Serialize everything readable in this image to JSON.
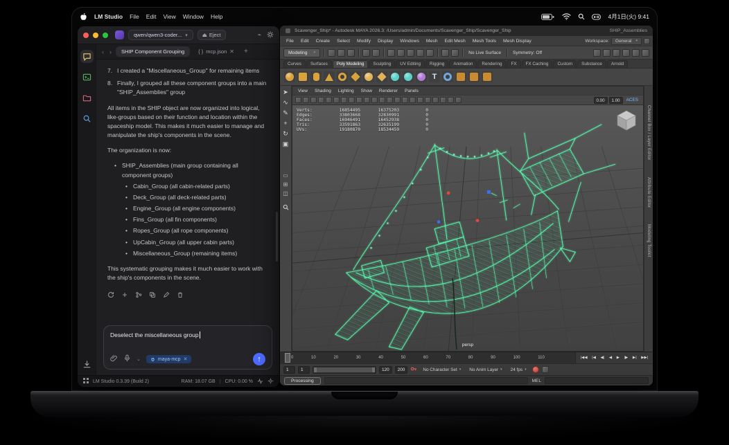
{
  "colors": {
    "accent_blue": "#4d6bfe",
    "selection_green": "#59ffb0",
    "chip_blue": "#1f3b66"
  },
  "menubar": {
    "app_name": "LM Studio",
    "items": [
      "File",
      "Edit",
      "View",
      "Window",
      "Help"
    ],
    "clock": "4月1日(火) 9:41"
  },
  "lmstudio": {
    "titlebar": {
      "model_selector": "qwen/qwen3-coder...",
      "eject_label": "Eject"
    },
    "tabs": {
      "active": "SHIP Component Grouping",
      "secondary": "mcp.json"
    },
    "chat": {
      "numbered": [
        {
          "num": "7.",
          "text": "I created a \"Miscellaneous_Group\" for remaining items"
        },
        {
          "num": "8.",
          "text": "Finally, I grouped all these component groups into a main \"SHIP_Assemblies\" group"
        }
      ],
      "para_summary": "All items in the SHIP object are now organized into logical, like-groups based on their function and location within the spaceship model. This makes it much easier to manage and manipulate the ship's components in the scene.",
      "para_org": "The organization is now:",
      "main_bullet": "SHIP_Assemblies (main group containing all component groups)",
      "sub_bullets": [
        "Cabin_Group (all cabin-related parts)",
        "Deck_Group (all deck-related parts)",
        "Engine_Group (all engine components)",
        "Fins_Group (all fin components)",
        "Ropes_Group (all rope components)",
        "UpCabin_Group (all upper cabin parts)",
        "Miscellaneous_Group (remaining items)"
      ],
      "para_closing": "This systematic grouping makes it much easier to work with the ship's components in the scene."
    },
    "composer": {
      "value": "Deselect the miscellaneous group",
      "chip": "maya-mcp"
    },
    "statusbar": {
      "version": "LM Studio 0.3.39 (Build 2)",
      "ram": "RAM: 18.07 GB",
      "cpu": "CPU: 0.00 %"
    }
  },
  "maya": {
    "title": "Scavenger_Ship* - Autodesk MAYA 2026.3: /Users/admin/Documents/Scavenger_Ship/Scavenger_Ship",
    "title_right": "SHIP_Assemblies",
    "menus": [
      "File",
      "Edit",
      "Create",
      "Select",
      "Modify",
      "Display",
      "Windows",
      "Mesh",
      "Edit Mesh",
      "Mesh Tools",
      "Mesh Display"
    ],
    "workspace_label": "Workspace:",
    "workspace_value": "General",
    "toolbar": {
      "mode": "Modeling",
      "no_live_surface": "No Live Surface",
      "symmetry": "Symmetry: Off"
    },
    "toolbar_icons_left": [
      "new-scene",
      "open-scene",
      "save-scene",
      "undo",
      "redo",
      "snap-to-grid",
      "snap-to-curve",
      "snap-to-point",
      "snap-to-projected-center",
      "snap-to-view-plane",
      "make-live",
      "construction-history"
    ],
    "toolbar_icons_right": [
      "render-current-frame",
      "ipr-render",
      "render-settings",
      "hypershade",
      "node-editor",
      "paint-effects"
    ],
    "shelf_tabs": [
      "Curves",
      "Surfaces",
      "Poly Modeling",
      "Sculpting",
      "UV Editing",
      "Rigging",
      "Animation",
      "Rendering",
      "FX",
      "FX Caching",
      "Custom",
      "Substance",
      "Arnold"
    ],
    "shelf_icons": [
      {
        "name": "poly-sphere",
        "shape": "circle",
        "color": "#d9a33c"
      },
      {
        "name": "poly-cube",
        "shape": "square",
        "color": "#d9a33c"
      },
      {
        "name": "poly-cylinder",
        "shape": "rect",
        "color": "#d9a33c"
      },
      {
        "name": "poly-cone",
        "shape": "triangle",
        "color": "#d9a33c"
      },
      {
        "name": "poly-torus",
        "shape": "ring",
        "color": "#d9a33c"
      },
      {
        "name": "poly-plane",
        "shape": "diamond",
        "color": "#d9a33c"
      },
      {
        "name": "poly-disc",
        "shape": "circle",
        "color": "#e0b25a"
      },
      {
        "name": "platonic-solid",
        "shape": "diamond",
        "color": "#e0b25a"
      },
      {
        "name": "super-ellipse",
        "shape": "circle",
        "color": "#5ad0c8"
      },
      {
        "name": "soccer-ball",
        "shape": "circle",
        "color": "#5ad0c8"
      },
      {
        "name": "ultra-shape",
        "shape": "circle",
        "color": "#b07cd6"
      },
      {
        "name": "type-tool",
        "shape": "letter-T",
        "color": "#cfe3f5"
      },
      {
        "name": "sweep-mesh",
        "shape": "ring",
        "color": "#6fa8dc"
      },
      {
        "name": "boolean",
        "shape": "square",
        "color": "#c98a30"
      },
      {
        "name": "combine",
        "shape": "square",
        "color": "#c98a30"
      },
      {
        "name": "separate",
        "shape": "square",
        "color": "#c98a30"
      }
    ],
    "toolbox": [
      {
        "name": "select-tool",
        "glyph": "➤"
      },
      {
        "name": "lasso-tool",
        "glyph": "∿"
      },
      {
        "name": "paint-select-tool",
        "glyph": "✎"
      },
      {
        "name": "move-tool",
        "glyph": "+"
      },
      {
        "name": "rotate-tool",
        "glyph": "↻"
      },
      {
        "name": "scale-tool",
        "glyph": "▣"
      }
    ],
    "toolbox_layouts": [
      {
        "name": "single-pane-layout",
        "glyph": "▭"
      },
      {
        "name": "four-pane-layout",
        "glyph": "⊞"
      },
      {
        "name": "two-pane-layout",
        "glyph": "◫"
      }
    ],
    "panel_menu": [
      "View",
      "Shading",
      "Lighting",
      "Show",
      "Renderer",
      "Panels"
    ],
    "viewport_icons": [
      "select-camera",
      "lock-camera",
      "camera-attributes",
      "bookmarks",
      "image-plane",
      "two-d-pan-zoom",
      "grease-pencil",
      "grid-toggle",
      "film-gate",
      "resolution-gate",
      "gate-mask",
      "field-chart",
      "safe-action",
      "safe-title",
      "frame-all",
      "frame-selection",
      "lighting-toggle",
      "shadows-toggle",
      "ambient-occlusion",
      "motion-blur",
      "multisample-aa",
      "isolate-select"
    ],
    "viewport_fields": {
      "exposure": "0.00",
      "gamma": "1.00",
      "color_space": "ACES"
    },
    "hud": [
      {
        "label": "Verts:",
        "v1": "16854495",
        "v2": "16375203",
        "v3": "0"
      },
      {
        "label": "Edges:",
        "v1": "33803668",
        "v2": "32830991",
        "v3": "0"
      },
      {
        "label": "Faces:",
        "v1": "16946491",
        "v2": "16452938",
        "v3": "0"
      },
      {
        "label": "Tris:",
        "v1": "33591863",
        "v2": "32635199",
        "v3": "0"
      },
      {
        "label": "UVs:",
        "v1": "19180870",
        "v2": "18534459",
        "v3": "0"
      }
    ],
    "camera_label": "persp",
    "right_tabs": [
      "Channel Box / Layer Editor",
      "Attribute Editor",
      "Modeling Toolkit"
    ],
    "timeline_ticks": [
      "0",
      "10",
      "20",
      "30",
      "40",
      "50",
      "60",
      "70",
      "80",
      "90",
      "100",
      "110"
    ],
    "transport": [
      {
        "name": "go-to-start",
        "glyph": "|◀◀"
      },
      {
        "name": "step-back-key",
        "glyph": "|◀"
      },
      {
        "name": "step-back-frame",
        "glyph": "◀|"
      },
      {
        "name": "play-backwards",
        "glyph": "◀"
      },
      {
        "name": "play-forwards",
        "glyph": "▶"
      },
      {
        "name": "step-forward-frame",
        "glyph": "|▶"
      },
      {
        "name": "step-forward-key",
        "glyph": "▶|"
      },
      {
        "name": "go-to-end",
        "glyph": "▶▶|"
      }
    ],
    "range": {
      "anim_start": "1",
      "play_start": "1",
      "play_end": "120",
      "anim_end": "200"
    },
    "anim_controls": {
      "character_set": "No Character Set",
      "anim_layer": "No Anim Layer",
      "fps": "24 fps"
    },
    "command_line": {
      "label": "MEL"
    },
    "help_line": "Processing"
  }
}
